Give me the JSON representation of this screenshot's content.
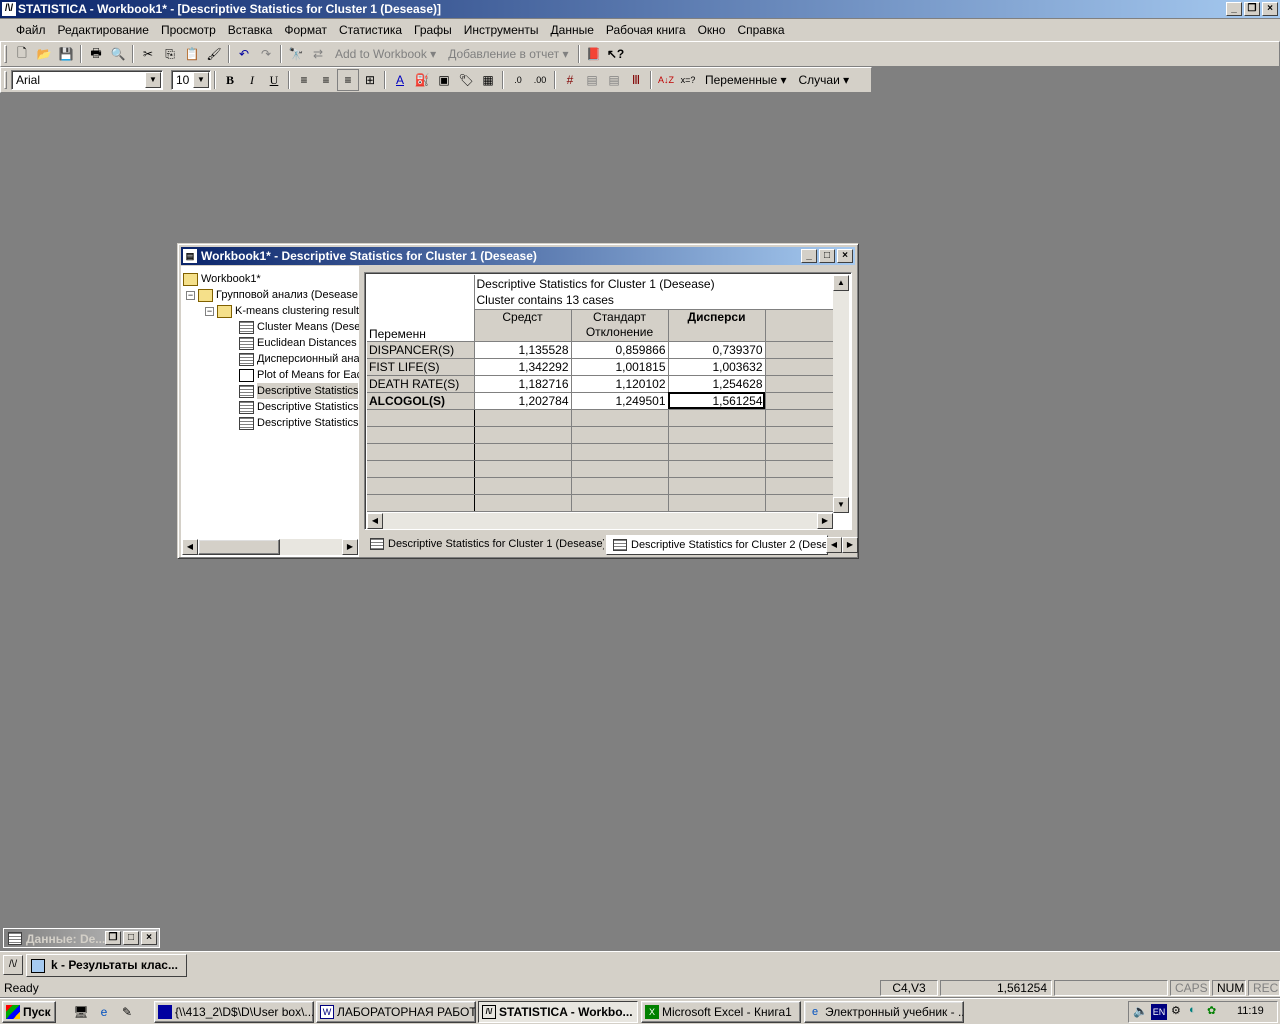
{
  "app": {
    "title": "STATISTICA - Workbook1* - [Descriptive Statistics for Cluster 1 (Desease)]",
    "icon_text": "/\\/"
  },
  "menu": [
    "Файл",
    "Редактирование",
    "Просмотр",
    "Вставка",
    "Формат",
    "Статистика",
    "Графы",
    "Инструменты",
    "Данные",
    "Рабочая книга",
    "Окно",
    "Справка"
  ],
  "toolbar1": {
    "add_to_workbook": "Add to Workbook",
    "add_to_report": "Добавление в отчет"
  },
  "toolbar2": {
    "font_name": "Arial",
    "font_size": "10",
    "bold": "B",
    "italic": "I",
    "underline": "U",
    "variables": "Переменные",
    "cases": "Случаи",
    "az": "A↓Z",
    "xeq": "x=?"
  },
  "workbook": {
    "title": "Workbook1* - Descriptive Statistics for Cluster 1 (Desease)",
    "tree": [
      {
        "label": "Workbook1*",
        "icon": "folder-open-icon",
        "level": 0
      },
      {
        "label": "Групповой анализ (Desease",
        "icon": "folder-open-icon",
        "level": 1,
        "expander": "−"
      },
      {
        "label": "K-means clustering result",
        "icon": "folder-open-icon",
        "level": 2,
        "expander": "−"
      },
      {
        "label": "Cluster Means (Desea",
        "icon": "spreadsheet-icon",
        "level": 3
      },
      {
        "label": "Euclidean Distances b",
        "icon": "spreadsheet-icon",
        "level": 3
      },
      {
        "label": "Дисперсионный ана",
        "icon": "spreadsheet-icon",
        "level": 3
      },
      {
        "label": "Plot of Means for Eac",
        "icon": "graph-icon",
        "level": 3
      },
      {
        "label": "Descriptive Statistics",
        "icon": "spreadsheet-icon",
        "level": 3,
        "selected": true
      },
      {
        "label": "Descriptive Statistics",
        "icon": "spreadsheet-icon",
        "level": 3
      },
      {
        "label": "Descriptive Statistics",
        "icon": "spreadsheet-icon",
        "level": 3
      }
    ],
    "grid": {
      "header_title": "Descriptive Statistics for Cluster 1 (Desease)",
      "header_subtitle": "Cluster contains 13 cases",
      "row_header_label": "Переменн",
      "columns": [
        {
          "l1": "Средст",
          "l2": ""
        },
        {
          "l1": "Стандарт",
          "l2": "Отклонение"
        },
        {
          "l1": "Дисперси",
          "l2": ""
        }
      ],
      "rows": [
        {
          "name": "DISPANCER(S)",
          "values": [
            "1,135528",
            "0,859866",
            "0,739370"
          ]
        },
        {
          "name": "FIST LIFE(S)",
          "values": [
            "1,342292",
            "1,001815",
            "1,003632"
          ]
        },
        {
          "name": "DEATH RATE(S)",
          "values": [
            "1,182716",
            "1,120102",
            "1,254628"
          ]
        },
        {
          "name": "ALCOGOL(S)",
          "values": [
            "1,202784",
            "1,249501",
            "1,561254"
          ]
        }
      ]
    },
    "tabs": [
      "Descriptive Statistics for Cluster 1 (Desease)",
      "Descriptive Statistics for Cluster 2 (Desea"
    ]
  },
  "minimized_window": "Данные: De...",
  "windows_bar": {
    "item": "k - Результаты клас..."
  },
  "statusbar": {
    "ready": "Ready",
    "cell": "C4,V3",
    "value": "1,561254",
    "caps": "CAPS",
    "num": "NUM",
    "rec": "REC"
  },
  "taskbar": {
    "start": "Пуск",
    "tasks": [
      "{\\\\413_2\\D$\\D\\User box\\...",
      "ЛАБОРАТОРНАЯ РАБОТ...",
      "STATISTICA - Workbo...",
      "Microsoft Excel - Книга1",
      "Электронный учебник - ..."
    ],
    "lang": "EN",
    "time": "11:19"
  }
}
